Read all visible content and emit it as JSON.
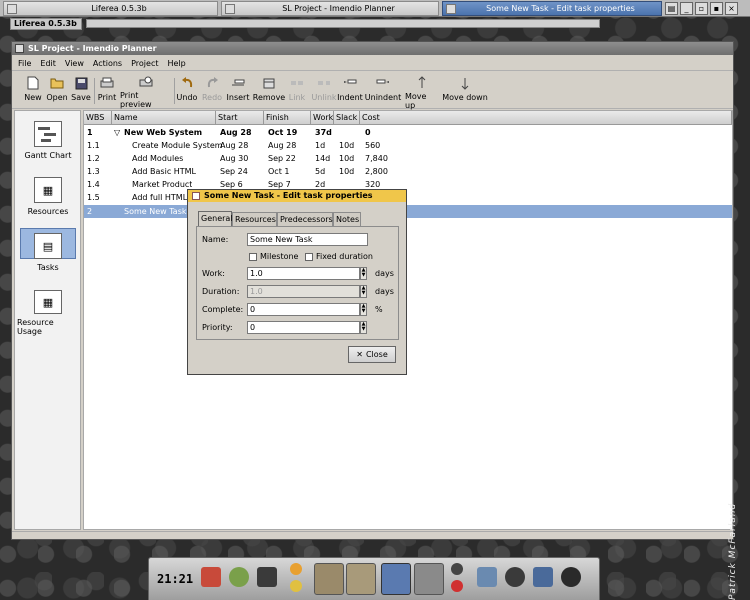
{
  "taskbar": {
    "tasks": [
      {
        "label": "Liferea 0.5.3b"
      },
      {
        "label": "SL Project - Imendio Planner"
      },
      {
        "label": "Some New Task - Edit task properties"
      }
    ]
  },
  "liferea_title": "Liferea 0.5.3b",
  "window": {
    "title": "SL Project - Imendio Planner",
    "menu": [
      "File",
      "Edit",
      "View",
      "Actions",
      "Project",
      "Help"
    ],
    "toolbar": {
      "new": "New",
      "open": "Open",
      "save": "Save",
      "print": "Print",
      "print_preview": "Print preview",
      "undo": "Undo",
      "redo": "Redo",
      "insert": "Insert",
      "remove": "Remove",
      "link": "Link",
      "unlink": "Unlink",
      "indent": "Indent",
      "unindent": "Unindent",
      "move_up": "Move up",
      "move_down": "Move down"
    },
    "sidebar": {
      "gantt": "Gantt Chart",
      "resources": "Resources",
      "tasks": "Tasks",
      "resource_usage": "Resource Usage"
    },
    "columns": {
      "wbs": "WBS",
      "name": "Name",
      "start": "Start",
      "finish": "Finish",
      "work": "Work",
      "slack": "Slack",
      "cost": "Cost"
    },
    "rows": [
      {
        "wbs": "1",
        "name": "New Web System",
        "start": "Aug 28",
        "finish": "Oct 19",
        "work": "37d",
        "slack": "",
        "cost": "0"
      },
      {
        "wbs": "1.1",
        "name": "Create Module System",
        "start": "Aug 28",
        "finish": "Aug 28",
        "work": "1d",
        "slack": "10d",
        "cost": "560"
      },
      {
        "wbs": "1.2",
        "name": "Add Modules",
        "start": "Aug 30",
        "finish": "Sep 22",
        "work": "14d",
        "slack": "10d",
        "cost": "7,840"
      },
      {
        "wbs": "1.3",
        "name": "Add Basic HTML",
        "start": "Sep 24",
        "finish": "Oct 1",
        "work": "5d",
        "slack": "10d",
        "cost": "2,800"
      },
      {
        "wbs": "1.4",
        "name": "Market Product",
        "start": "Sep 6",
        "finish": "Sep 7",
        "work": "2d",
        "slack": "",
        "cost": "320"
      },
      {
        "wbs": "1.5",
        "name": "Add full HTML s",
        "start": "",
        "finish": "",
        "work": "",
        "slack": "",
        "cost": "000"
      },
      {
        "wbs": "2",
        "name": "Some New Task",
        "start": "",
        "finish": "",
        "work": "",
        "slack": "",
        "cost": ""
      }
    ]
  },
  "dialog": {
    "title": "Some New Task - Edit task properties",
    "tabs": [
      "General",
      "Resources",
      "Predecessors",
      "Notes"
    ],
    "name_label": "Name:",
    "name_value": "Some New Task",
    "milestone": "Milestone",
    "fixed_duration": "Fixed duration",
    "work_label": "Work:",
    "work_value": "1.0",
    "work_unit": "days",
    "duration_label": "Duration:",
    "duration_value": "1.0",
    "duration_unit": "days",
    "complete_label": "Complete:",
    "complete_value": "0",
    "complete_unit": "%",
    "priority_label": "Priority:",
    "priority_value": "0",
    "close": "Close"
  },
  "clock": "21:21",
  "signature": "Patrick McFarland",
  "colors": {
    "selection": "#8aa9d6",
    "dialog_title": "#f0c64a"
  }
}
